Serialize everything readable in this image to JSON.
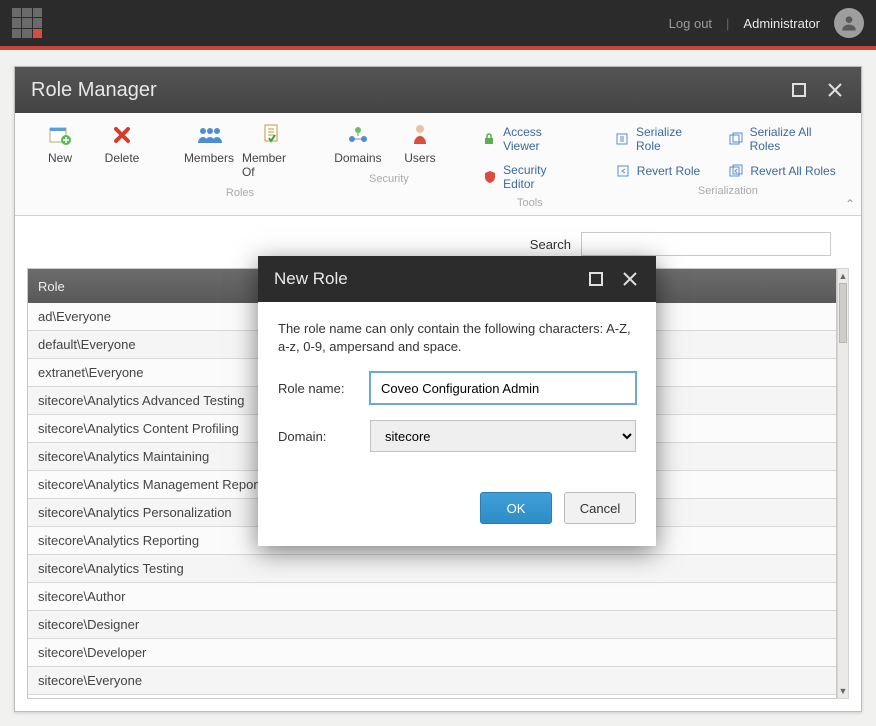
{
  "topbar": {
    "logout": "Log out",
    "username": "Administrator"
  },
  "window": {
    "title": "Role Manager"
  },
  "ribbon": {
    "groups": [
      {
        "label": "",
        "buttons": [
          "New",
          "Delete"
        ]
      },
      {
        "label": "Roles",
        "buttons": [
          "Members",
          "Member Of"
        ]
      },
      {
        "label": "Security",
        "buttons": [
          "Domains",
          "Users"
        ]
      }
    ],
    "tools": {
      "label": "Tools",
      "items": [
        "Access Viewer",
        "Security Editor"
      ]
    },
    "serialization": {
      "label": "Serialization",
      "col1": [
        "Serialize Role",
        "Revert Role"
      ],
      "col2": [
        "Serialize All Roles",
        "Revert All Roles"
      ]
    }
  },
  "search": {
    "label": "Search"
  },
  "table": {
    "header": "Role",
    "rows": [
      "ad\\Everyone",
      "default\\Everyone",
      "extranet\\Everyone",
      "sitecore\\Analytics Advanced Testing",
      "sitecore\\Analytics Content Profiling",
      "sitecore\\Analytics Maintaining",
      "sitecore\\Analytics Management Reporting",
      "sitecore\\Analytics Personalization",
      "sitecore\\Analytics Reporting",
      "sitecore\\Analytics Testing",
      "sitecore\\Author",
      "sitecore\\Designer",
      "sitecore\\Developer",
      "sitecore\\Everyone"
    ]
  },
  "modal": {
    "title": "New Role",
    "helptext": "The role name can only contain the following characters: A-Z, a-z, 0-9, ampersand and space.",
    "rolename_label": "Role name:",
    "rolename_value": "Coveo Configuration Admin",
    "domain_label": "Domain:",
    "domain_value": "sitecore",
    "ok": "OK",
    "cancel": "Cancel"
  }
}
